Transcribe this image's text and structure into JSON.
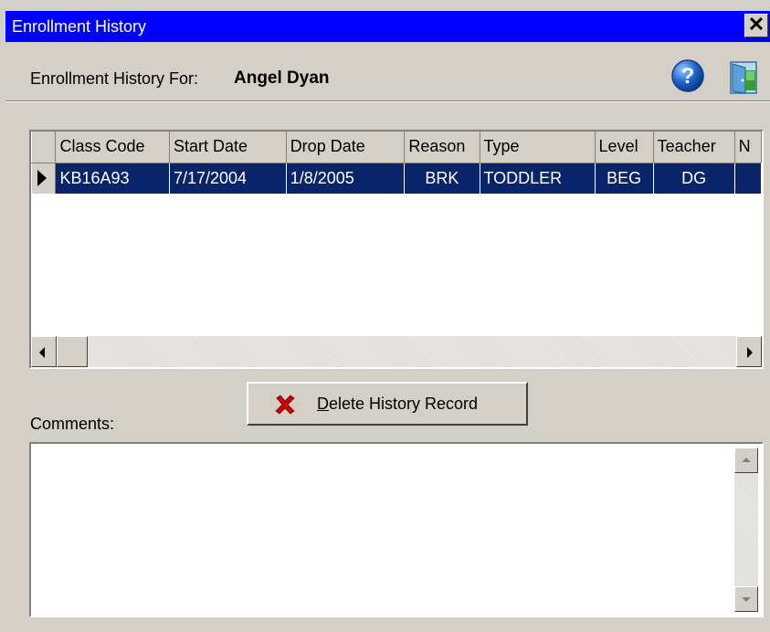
{
  "window": {
    "title": "Enrollment History",
    "close_glyph": "✕"
  },
  "header": {
    "label": "Enrollment History For:",
    "student_name": "Angel Dyan"
  },
  "icons": {
    "help": "help-icon",
    "exit": "exit-door-icon",
    "delete": "red-x-icon"
  },
  "colors": {
    "titlebar": "#0000ff",
    "selected_row": "#0a246a",
    "delete_icon": "#cc0000",
    "help_icon": "#1e64c8",
    "exit_door": "#3a9a3a"
  },
  "grid": {
    "columns": [
      "Class Code",
      "Start Date",
      "Drop Date",
      "Reason",
      "Type",
      "Level",
      "Teacher",
      "N"
    ],
    "rows": [
      {
        "class_code": "KB16A93",
        "start_date": "7/17/2004",
        "drop_date": "1/8/2005",
        "reason": "BRK",
        "type": "TODDLER",
        "level": "BEG",
        "teacher": "DG",
        "n": ""
      }
    ]
  },
  "actions": {
    "delete_label_accel": "D",
    "delete_label_rest": "elete History Record"
  },
  "comments": {
    "label": "Comments:",
    "value": ""
  }
}
